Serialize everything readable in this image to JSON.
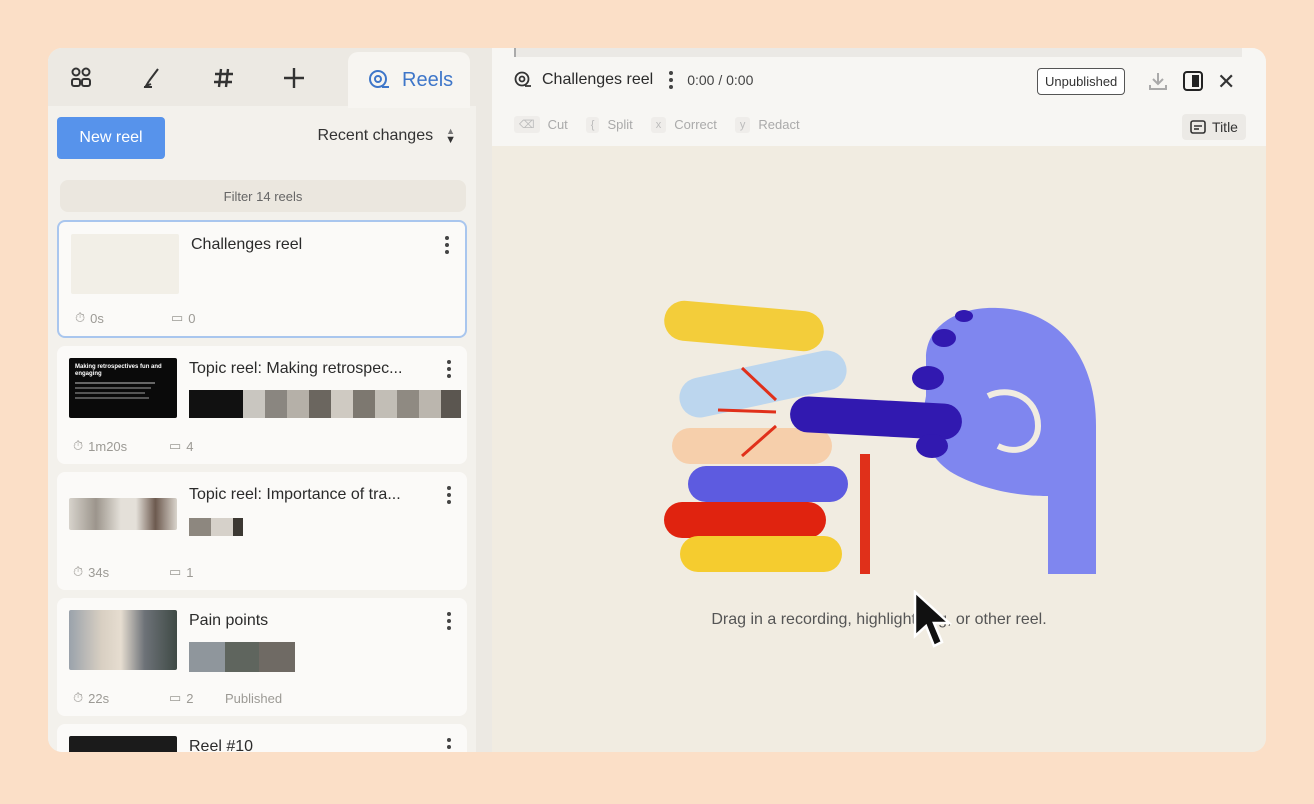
{
  "nav": {
    "icons": [
      "people-icon",
      "highlight-icon",
      "hashtag-icon",
      "plus-icon"
    ],
    "active_tab_label": "Reels"
  },
  "left": {
    "new_reel_label": "New reel",
    "sort_label": "Recent changes",
    "filter_placeholder": "Filter 14 reels"
  },
  "reels": [
    {
      "title": "Challenges reel",
      "duration": "0s",
      "count": "0",
      "status": ""
    },
    {
      "title": "Topic reel: Making retrospec...",
      "duration": "1m20s",
      "count": "4",
      "status": ""
    },
    {
      "title": "Topic reel: Importance of tra...",
      "duration": "34s",
      "count": "1",
      "status": ""
    },
    {
      "title": "Pain points",
      "duration": "22s",
      "count": "2",
      "status": "Published"
    },
    {
      "title": "Reel #10",
      "duration": "",
      "count": "",
      "status": ""
    }
  ],
  "thumb_text": "Making retrospectives fun and engaging",
  "editor": {
    "reel_name": "Challenges reel",
    "time": "0:00 / 0:00",
    "status_badge": "Unpublished",
    "tools": [
      {
        "key": "⌫",
        "label": "Cut"
      },
      {
        "key": "{",
        "label": "Split"
      },
      {
        "key": "x",
        "label": "Correct"
      },
      {
        "key": "y",
        "label": "Redact"
      }
    ],
    "title_button": "Title",
    "empty_hint": "Drag in a recording, highlight, tag, or other reel."
  },
  "colors": {
    "accent": "#5793eb",
    "active_tab_text": "#3e76c9",
    "selected_border": "#a9c6ee",
    "background": "#fbdfc7"
  }
}
